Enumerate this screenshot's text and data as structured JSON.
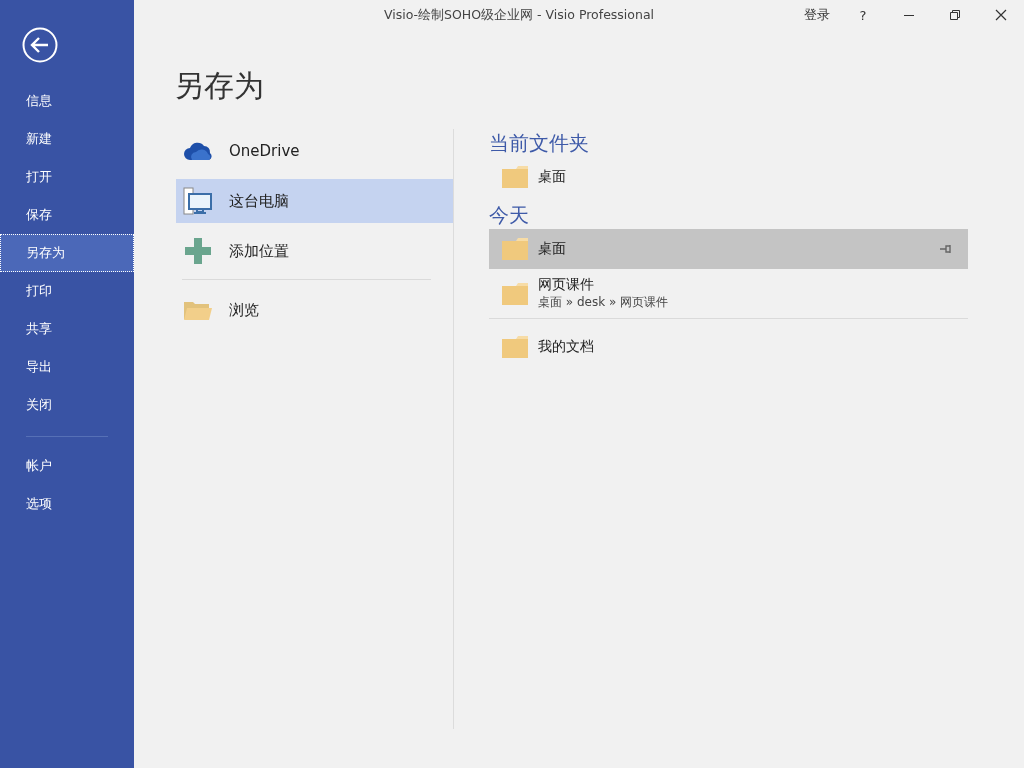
{
  "window": {
    "title": "Visio-绘制SOHO级企业网 - Visio Professional",
    "sign_in": "登录",
    "help": "?"
  },
  "sidebar": {
    "items": [
      {
        "label": "信息",
        "selected": false
      },
      {
        "label": "新建",
        "selected": false
      },
      {
        "label": "打开",
        "selected": false
      },
      {
        "label": "保存",
        "selected": false
      },
      {
        "label": "另存为",
        "selected": true
      },
      {
        "label": "打印",
        "selected": false
      },
      {
        "label": "共享",
        "selected": false
      },
      {
        "label": "导出",
        "selected": false
      },
      {
        "label": "关闭",
        "selected": false
      }
    ],
    "footer_items": [
      {
        "label": "帐户",
        "selected": false
      },
      {
        "label": "选项",
        "selected": false
      }
    ]
  },
  "page_title": "另存为",
  "locations": [
    {
      "kind": "onedrive",
      "label": "OneDrive",
      "selected": false
    },
    {
      "kind": "computer",
      "label": "这台电脑",
      "selected": true
    },
    {
      "kind": "add",
      "label": "添加位置",
      "selected": false
    },
    {
      "kind": "browse",
      "label": "浏览",
      "selected": false
    }
  ],
  "folder_sections": [
    {
      "heading": "当前文件夹",
      "items": [
        {
          "name": "桌面",
          "selected": false
        }
      ]
    },
    {
      "heading": "今天",
      "items": [
        {
          "name": "桌面",
          "selected": true
        },
        {
          "name": "网页课件",
          "path": "桌面 » desk » 网页课件",
          "selected": false
        }
      ]
    },
    {
      "items": [
        {
          "name": "我的文档",
          "selected": false
        }
      ]
    }
  ]
}
